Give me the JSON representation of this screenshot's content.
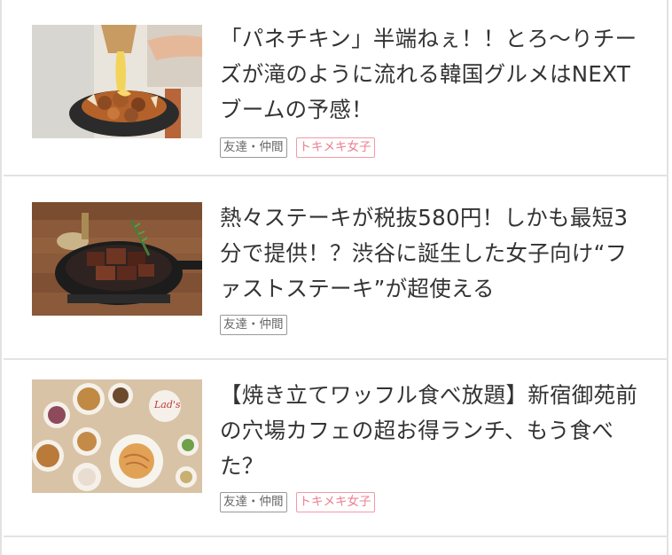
{
  "articles": [
    {
      "title": "「パネチキン」半端ねぇ！！とろ〜りチーズが滝のように流れる韓国グルメはNEXTブームの予感！",
      "tags": [
        "友達・仲間",
        "トキメキ女子"
      ]
    },
    {
      "title": "熱々ステーキが税抜580円！しかも最短3分で提供！？渋谷に誕生した女子向け“ファストステーキ”が超使える",
      "tags": [
        "友達・仲間"
      ]
    },
    {
      "title": "【焼き立てワッフル食べ放題】新宿御苑前の穴場カフェの超お得ランチ、もう食べた？",
      "tags": [
        "友達・仲間",
        "トキメキ女子"
      ]
    }
  ],
  "colors": {
    "text": "#333333",
    "tag_gray": "#666666",
    "tag_pink": "#ec7f8f",
    "divider": "#e3e3e3"
  },
  "icons": [
    "panechicken-photo",
    "steak-skillet-photo",
    "waffle-table-photo"
  ]
}
